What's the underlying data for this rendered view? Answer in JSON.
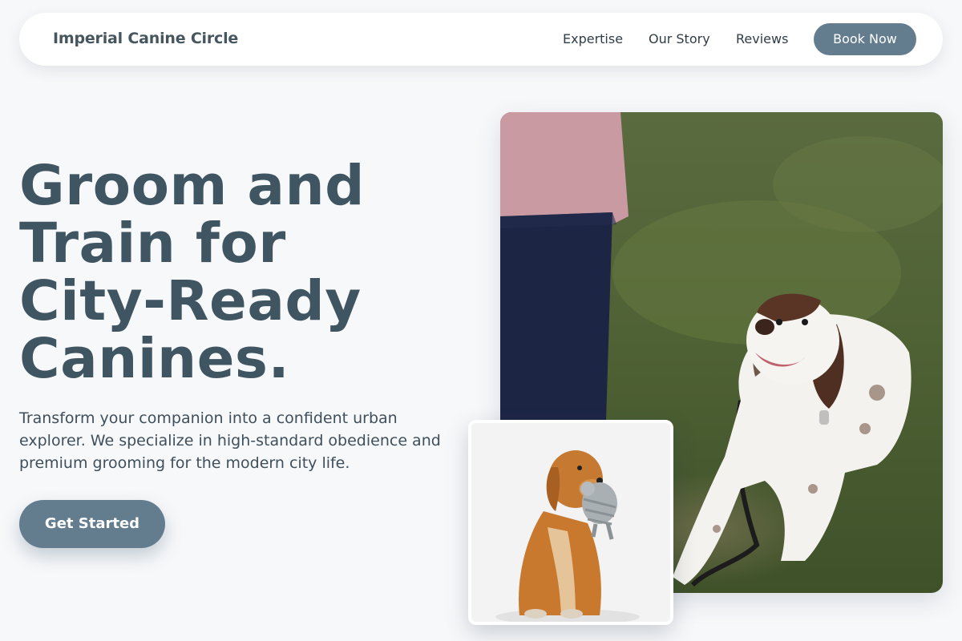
{
  "nav": {
    "brand": "Imperial Canine Circle",
    "links": [
      "Expertise",
      "Our Story",
      "Reviews"
    ],
    "cta": "Book Now"
  },
  "hero": {
    "title_lines": [
      "Groom and",
      "Train for",
      "City-Ready",
      "Canines."
    ],
    "subtitle": "Transform your companion into a confident urban explorer. We specialize in high-standard obedience and premium grooming for the modern city life.",
    "cta": "Get Started"
  },
  "images": {
    "main": "photo of a brown and white spaniel lying on grass looking up at its owner",
    "inset": "photo of a golden retriever-type dog holding a grey toy in its mouth"
  },
  "colors": {
    "accent": "#637d8f",
    "heading": "#405562",
    "background": "#f7f8fa"
  }
}
